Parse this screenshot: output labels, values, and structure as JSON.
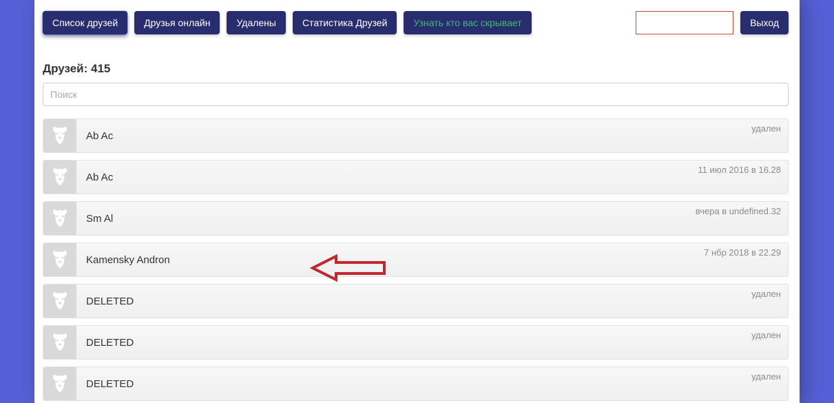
{
  "nav": {
    "friends_list": "Список друзей",
    "friends_online": "Друзья онлайн",
    "deleted": "Удалены",
    "stats": "Статистика Друзей",
    "who_hides": "Узнать кто вас скрывает",
    "logout": "Выход"
  },
  "count_label": "Друзей: 415",
  "search_placeholder": "Поиск",
  "rows": [
    {
      "name": "Ab Ac",
      "meta": "удален"
    },
    {
      "name": "Ab Ac",
      "meta": "11 июл 2016 в 16.28"
    },
    {
      "name": "Sm Al",
      "meta": "вчера в undefined.32"
    },
    {
      "name": "Kamensky Andron",
      "meta": "7 нбр 2018 в 22.29"
    },
    {
      "name": "DELETED",
      "meta": "удален"
    },
    {
      "name": "DELETED",
      "meta": "удален"
    },
    {
      "name": "DELETED",
      "meta": "удален"
    }
  ]
}
